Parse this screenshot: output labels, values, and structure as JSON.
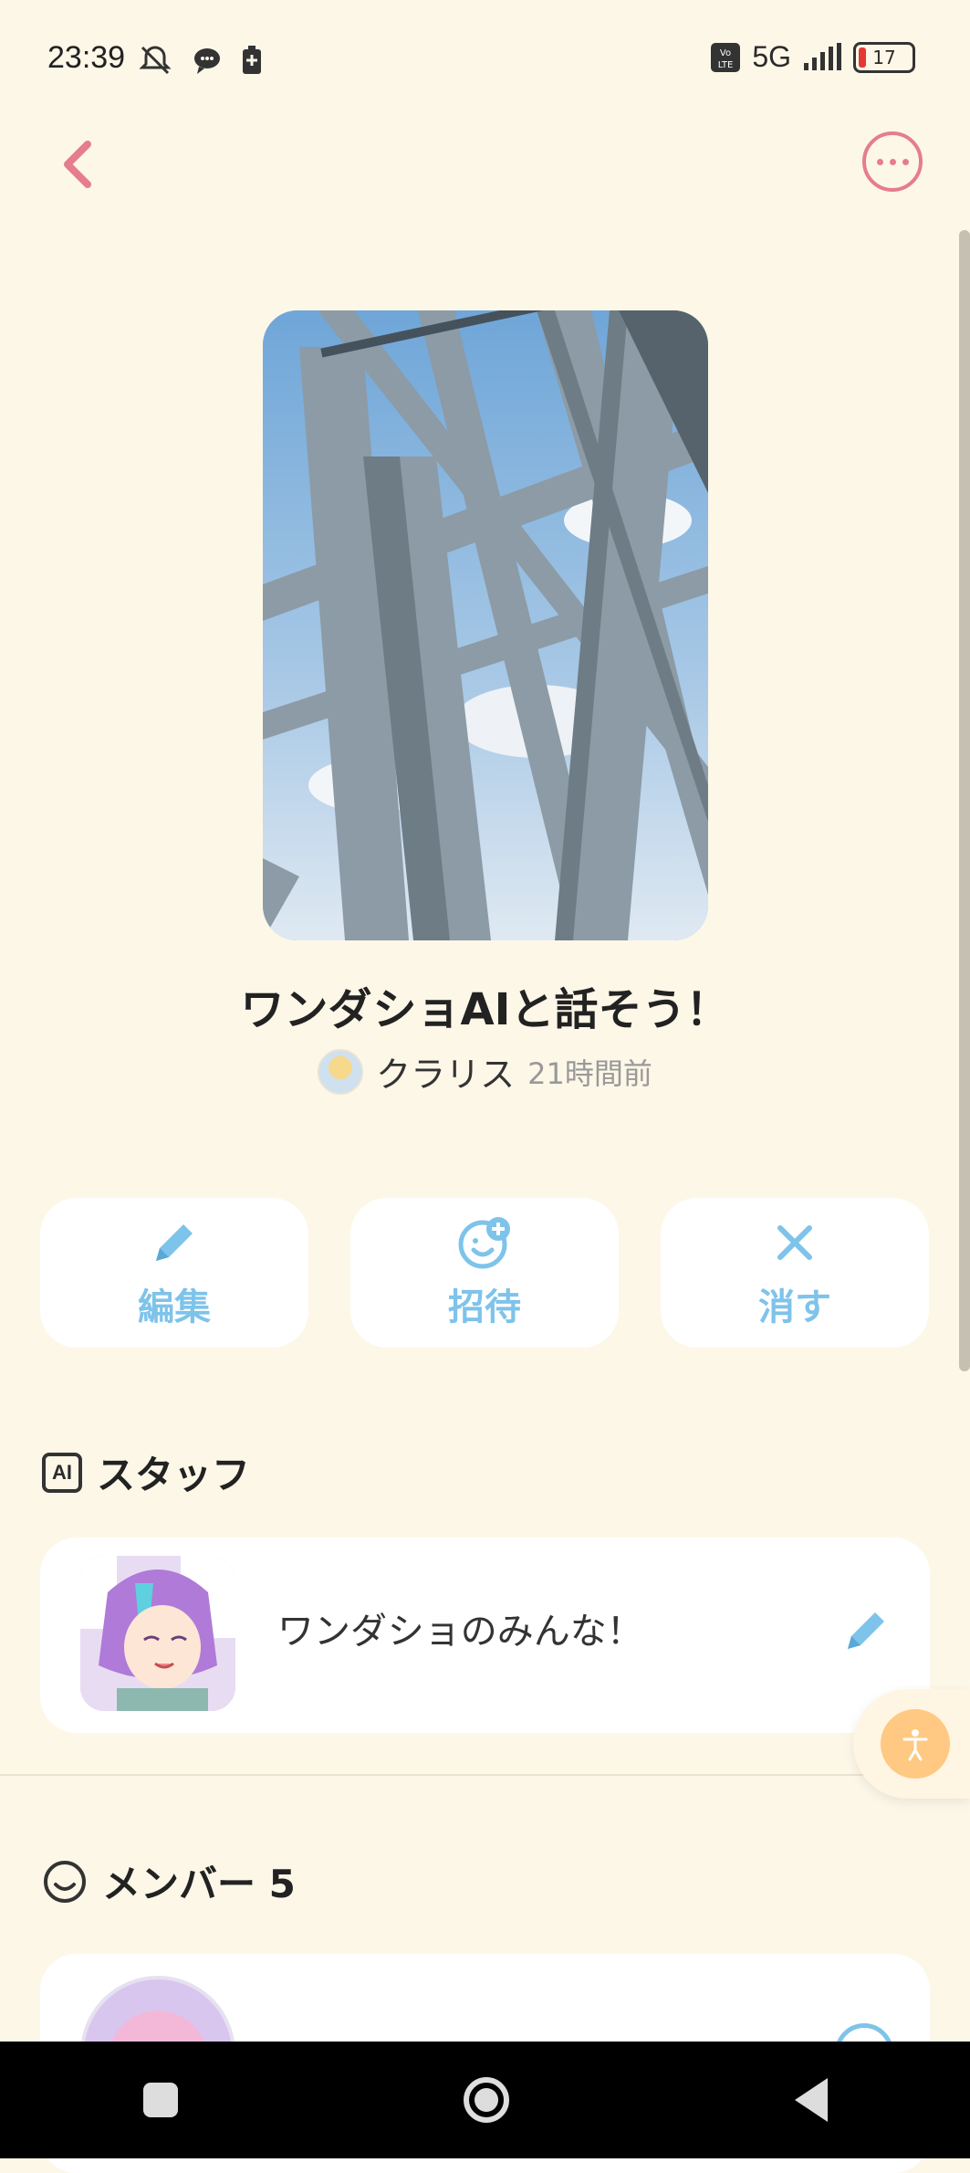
{
  "status": {
    "time": "23:39",
    "network": "5G",
    "battery": "17",
    "icons_left": [
      "mute-icon",
      "chat-bubble-icon",
      "battery-saver-icon"
    ],
    "icons_right": [
      "volte-icon",
      "network-5g-icon",
      "signal-icon",
      "battery-icon"
    ]
  },
  "nav": {
    "back_icon": "chevron-left-icon",
    "more_icon": "more-horizontal-icon"
  },
  "room": {
    "title": "ワンダショAIと話そう！",
    "owner_name": "クラリス",
    "owner_time": "21時間前"
  },
  "actions": [
    {
      "label": "編集",
      "icon": "pencil-icon"
    },
    {
      "label": "招待",
      "icon": "add-person-icon"
    },
    {
      "label": "消す",
      "icon": "close-icon"
    }
  ],
  "staff_section": {
    "badge": "AI",
    "title": "スタッフ",
    "item_name": "ワンダショのみんな！"
  },
  "member_section": {
    "title": "メンバー 5"
  },
  "colors": {
    "background": "#fdf7e8",
    "accent_pink": "#e57d8f",
    "accent_blue": "#7ec3ea",
    "fab_orange": "#ffc983"
  }
}
